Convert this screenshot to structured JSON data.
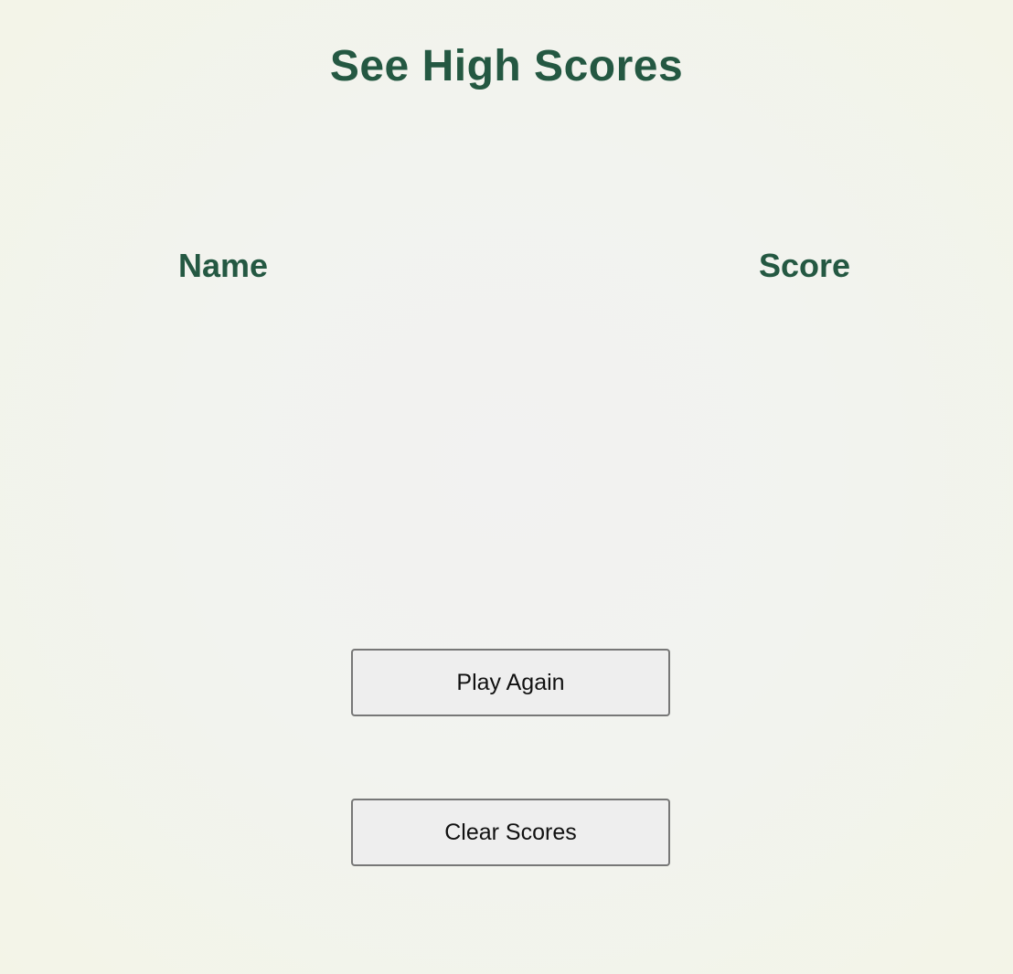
{
  "page": {
    "title": "See High Scores"
  },
  "scores_table": {
    "headers": {
      "name": "Name",
      "score": "Score"
    },
    "rows": []
  },
  "actions": {
    "play_again_label": "Play Again",
    "clear_scores_label": "Clear Scores"
  },
  "colors": {
    "heading": "#245842",
    "button_background": "#eeeeee",
    "button_border": "#777777",
    "background": "#f3f4e7"
  }
}
